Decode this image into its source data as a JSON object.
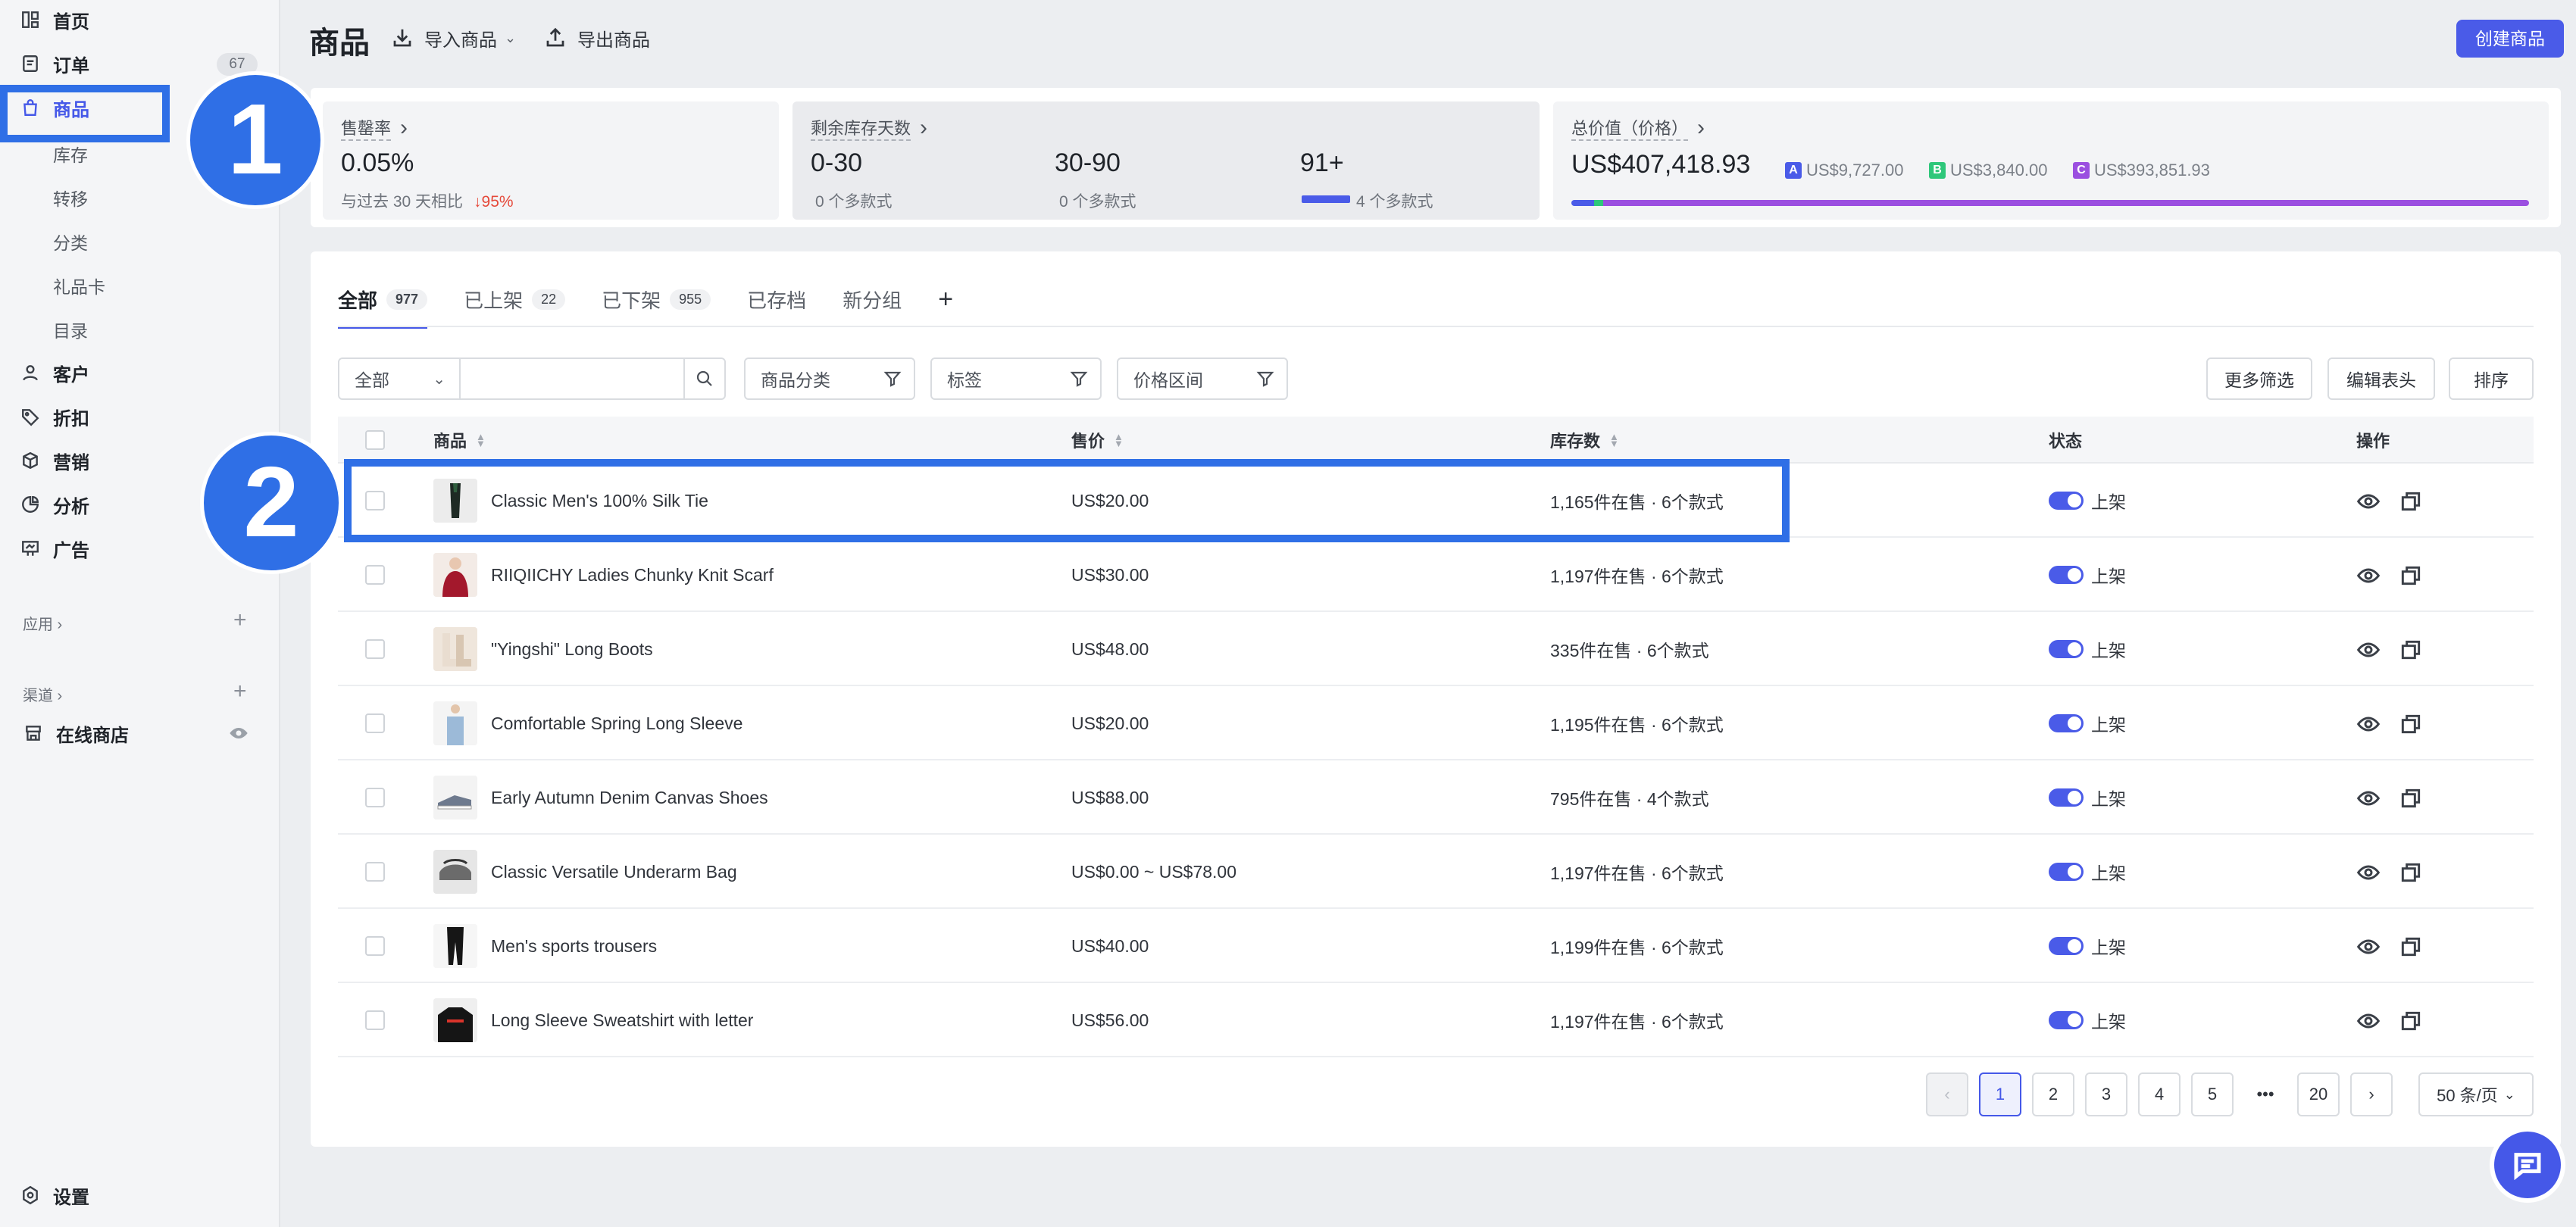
{
  "sidebar": {
    "items": [
      {
        "label": "首页",
        "icon": "dashboard-icon"
      },
      {
        "label": "订单",
        "icon": "order-icon",
        "count": "67"
      },
      {
        "label": "商品",
        "icon": "bag-icon",
        "active": true
      },
      {
        "label": "客户",
        "icon": "person-icon"
      },
      {
        "label": "折扣",
        "icon": "tag-icon"
      },
      {
        "label": "营销",
        "icon": "cube-icon"
      },
      {
        "label": "分析",
        "icon": "pie-icon"
      },
      {
        "label": "广告",
        "icon": "billboard-icon"
      }
    ],
    "sub_items": [
      "库存",
      "转移",
      "分类",
      "礼品卡",
      "目录"
    ],
    "apps_label": "应用",
    "channels_label": "渠道",
    "online_store": "在线商店",
    "settings": "设置"
  },
  "annotations": {
    "one": "1",
    "two": "2"
  },
  "header": {
    "title": "商品",
    "import_label": "导入商品",
    "export_label": "导出商品",
    "create_label": "创建商品"
  },
  "stats": {
    "sell_through": {
      "title": "售罄率",
      "value": "0.05%",
      "compare": "与过去 30 天相比",
      "change": "95%"
    },
    "inventory_days": {
      "title": "剩余库存天数",
      "buckets": [
        {
          "range": "0-30",
          "sub": "0 个多款式"
        },
        {
          "range": "30-90",
          "sub": "0 个多款式"
        },
        {
          "range": "91+",
          "sub": "4 个多款式"
        }
      ]
    },
    "total_value": {
      "title": "总价值（价格）",
      "value": "US$407,418.93",
      "segments": [
        {
          "tag": "A",
          "amount": "US$9,727.00",
          "color": "#4a5be8"
        },
        {
          "tag": "B",
          "amount": "US$3,840.00",
          "color": "#2ec77a"
        },
        {
          "tag": "C",
          "amount": "US$393,851.93",
          "color": "#9b4fe0"
        }
      ]
    }
  },
  "tabs": [
    {
      "label": "全部",
      "count": "977"
    },
    {
      "label": "已上架",
      "count": "22"
    },
    {
      "label": "已下架",
      "count": "955"
    },
    {
      "label": "已存档",
      "count": ""
    },
    {
      "label": "新分组",
      "count": ""
    }
  ],
  "filters": {
    "scope": "全部",
    "search_placeholder": "",
    "category": "商品分类",
    "tags": "标签",
    "price_range": "价格区间",
    "more": "更多筛选",
    "edit_columns": "编辑表头",
    "sort": "排序"
  },
  "table": {
    "columns": [
      "商品",
      "售价",
      "库存数",
      "状态",
      "操作"
    ],
    "rows": [
      {
        "name": "Classic Men's 100% Silk Tie",
        "price": "US$20.00",
        "stock": "1,165件在售 · 6个款式",
        "status": "上架"
      },
      {
        "name": "RIIQIICHY Ladies Chunky Knit Scarf",
        "price": "US$30.00",
        "stock": "1,197件在售 · 6个款式",
        "status": "上架"
      },
      {
        "name": "\"Yingshi\" Long Boots",
        "price": "US$48.00",
        "stock": "335件在售 · 6个款式",
        "status": "上架"
      },
      {
        "name": "Comfortable Spring Long Sleeve",
        "price": "US$20.00",
        "stock": "1,195件在售 · 6个款式",
        "status": "上架"
      },
      {
        "name": "Early Autumn Denim Canvas Shoes",
        "price": "US$88.00",
        "stock": "795件在售 · 4个款式",
        "status": "上架"
      },
      {
        "name": "Classic Versatile Underarm Bag",
        "price": "US$0.00 ~ US$78.00",
        "stock": "1,197件在售 · 6个款式",
        "status": "上架"
      },
      {
        "name": "Men's sports trousers",
        "price": "US$40.00",
        "stock": "1,199件在售 · 6个款式",
        "status": "上架"
      },
      {
        "name": "Long Sleeve Sweatshirt with letter",
        "price": "US$56.00",
        "stock": "1,197件在售 · 6个款式",
        "status": "上架"
      }
    ]
  },
  "pagination": {
    "pages": [
      "1",
      "2",
      "3",
      "4",
      "5"
    ],
    "ellipsis": "•••",
    "last": "20",
    "current": "1",
    "page_size": "50 条/页"
  }
}
